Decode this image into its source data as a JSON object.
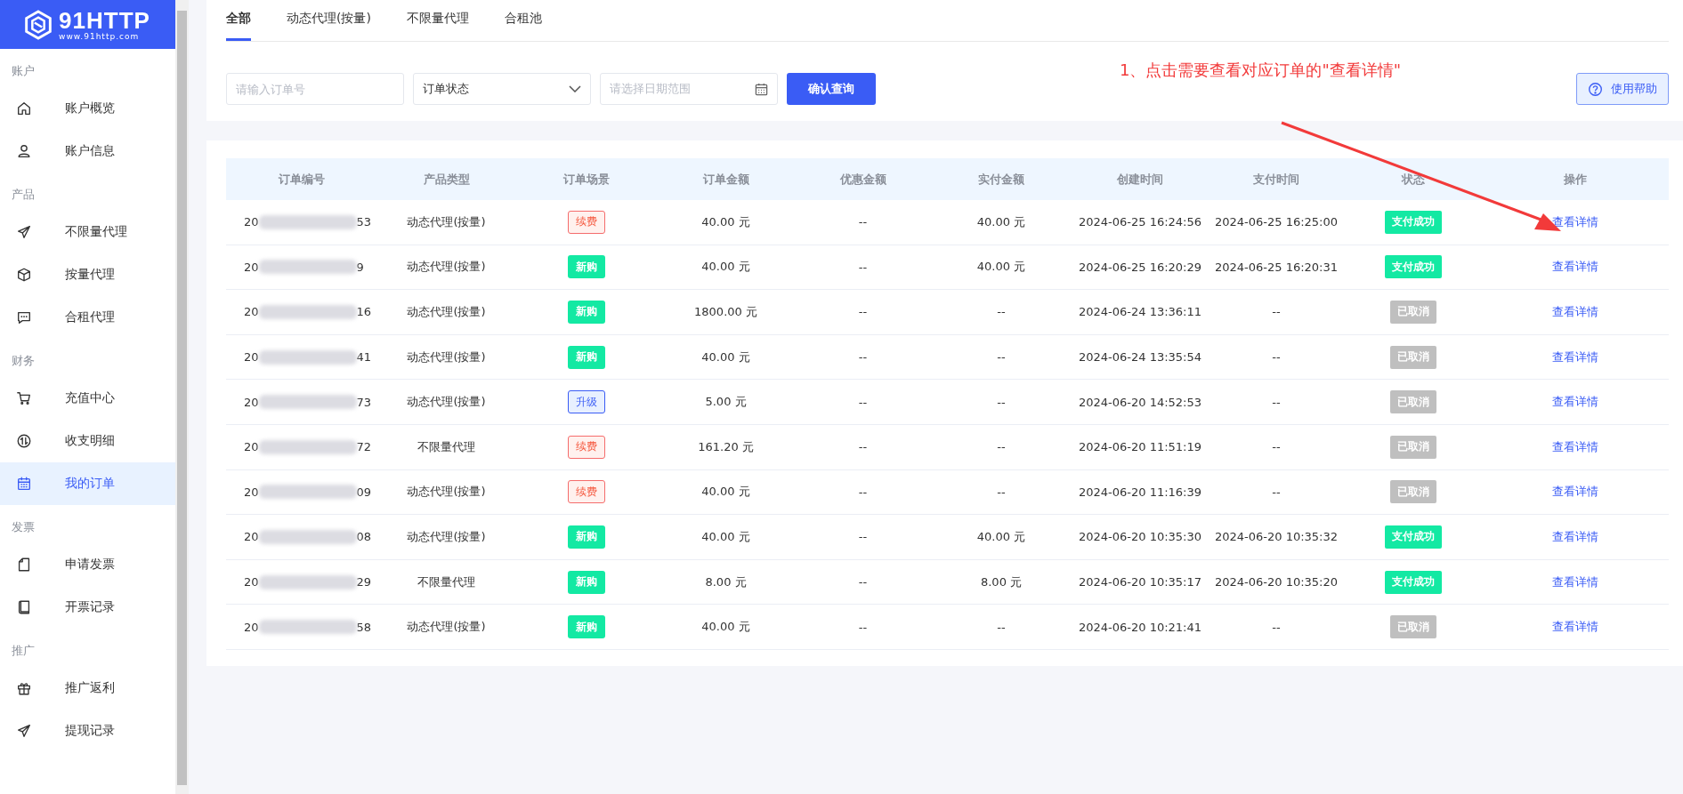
{
  "logo": {
    "name": "91HTTP",
    "url": "www.91http.com"
  },
  "sidebar": {
    "sections": [
      {
        "title": "账户",
        "items": [
          {
            "label": "账户概览",
            "selected": false
          },
          {
            "label": "账户信息",
            "selected": false
          }
        ]
      },
      {
        "title": "产品",
        "items": [
          {
            "label": "不限量代理",
            "selected": false
          },
          {
            "label": "按量代理",
            "selected": false
          },
          {
            "label": "合租代理",
            "selected": false
          }
        ]
      },
      {
        "title": "财务",
        "items": [
          {
            "label": "充值中心",
            "selected": false
          },
          {
            "label": "收支明细",
            "selected": false
          },
          {
            "label": "我的订单",
            "selected": true
          }
        ]
      },
      {
        "title": "发票",
        "items": [
          {
            "label": "申请发票",
            "selected": false
          },
          {
            "label": "开票记录",
            "selected": false
          }
        ]
      },
      {
        "title": "推广",
        "items": [
          {
            "label": "推广返利",
            "selected": false
          },
          {
            "label": "提现记录",
            "selected": false
          }
        ]
      }
    ]
  },
  "tabs": [
    {
      "label": "全部",
      "selected": true
    },
    {
      "label": "动态代理(按量)",
      "selected": false
    },
    {
      "label": "不限量代理",
      "selected": false
    },
    {
      "label": "合租池",
      "selected": false
    }
  ],
  "filters": {
    "order_field": {
      "placeholder": "请输入订单号"
    },
    "status_select": {
      "value": "订单状态"
    },
    "date_field": {
      "placeholder": "请选择日期范围"
    },
    "query_button": "确认查询"
  },
  "help_button": "使用帮助",
  "annotation": {
    "text": "1、点击需要查看对应订单的\"查看详情\""
  },
  "table": {
    "columns": [
      "订单编号",
      "产品类型",
      "订单场景",
      "订单金额",
      "优惠金额",
      "实付金额",
      "创建时间",
      "支付时间",
      "状态",
      "操作"
    ],
    "rows": [
      {
        "order_prefix": "20",
        "order_suffix": "53",
        "product": "动态代理(按量)",
        "scene": {
          "label": "续费",
          "kind": "renew"
        },
        "amount": "40.00 元",
        "discount": "--",
        "paid": "40.00 元",
        "created": "2024-06-25 16:24:56",
        "paid_time": "2024-06-25 16:25:00",
        "status": {
          "label": "支付成功",
          "kind": "paid"
        },
        "action": "查看详情"
      },
      {
        "order_prefix": "20",
        "order_suffix": "9",
        "product": "动态代理(按量)",
        "scene": {
          "label": "新购",
          "kind": "new"
        },
        "amount": "40.00 元",
        "discount": "--",
        "paid": "40.00 元",
        "created": "2024-06-25 16:20:29",
        "paid_time": "2024-06-25 16:20:31",
        "status": {
          "label": "支付成功",
          "kind": "paid"
        },
        "action": "查看详情"
      },
      {
        "order_prefix": "20",
        "order_suffix": "16",
        "product": "动态代理(按量)",
        "scene": {
          "label": "新购",
          "kind": "new"
        },
        "amount": "1800.00 元",
        "discount": "--",
        "paid": "--",
        "created": "2024-06-24 13:36:11",
        "paid_time": "--",
        "status": {
          "label": "已取消",
          "kind": "cancelled"
        },
        "action": "查看详情"
      },
      {
        "order_prefix": "20",
        "order_suffix": "41",
        "product": "动态代理(按量)",
        "scene": {
          "label": "新购",
          "kind": "new"
        },
        "amount": "40.00 元",
        "discount": "--",
        "paid": "--",
        "created": "2024-06-24 13:35:54",
        "paid_time": "--",
        "status": {
          "label": "已取消",
          "kind": "cancelled"
        },
        "action": "查看详情"
      },
      {
        "order_prefix": "20",
        "order_suffix": "73",
        "product": "动态代理(按量)",
        "scene": {
          "label": "升级",
          "kind": "upgrade"
        },
        "amount": "5.00 元",
        "discount": "--",
        "paid": "--",
        "created": "2024-06-20 14:52:53",
        "paid_time": "--",
        "status": {
          "label": "已取消",
          "kind": "cancelled"
        },
        "action": "查看详情"
      },
      {
        "order_prefix": "20",
        "order_suffix": "72",
        "product": "不限量代理",
        "scene": {
          "label": "续费",
          "kind": "renew"
        },
        "amount": "161.20 元",
        "discount": "--",
        "paid": "--",
        "created": "2024-06-20 11:51:19",
        "paid_time": "--",
        "status": {
          "label": "已取消",
          "kind": "cancelled"
        },
        "action": "查看详情"
      },
      {
        "order_prefix": "20",
        "order_suffix": "09",
        "product": "动态代理(按量)",
        "scene": {
          "label": "续费",
          "kind": "renew"
        },
        "amount": "40.00 元",
        "discount": "--",
        "paid": "--",
        "created": "2024-06-20 11:16:39",
        "paid_time": "--",
        "status": {
          "label": "已取消",
          "kind": "cancelled"
        },
        "action": "查看详情"
      },
      {
        "order_prefix": "20",
        "order_suffix": "08",
        "product": "动态代理(按量)",
        "scene": {
          "label": "新购",
          "kind": "new"
        },
        "amount": "40.00 元",
        "discount": "--",
        "paid": "40.00 元",
        "created": "2024-06-20 10:35:30",
        "paid_time": "2024-06-20 10:35:32",
        "status": {
          "label": "支付成功",
          "kind": "paid"
        },
        "action": "查看详情"
      },
      {
        "order_prefix": "20",
        "order_suffix": "29",
        "product": "不限量代理",
        "scene": {
          "label": "新购",
          "kind": "new"
        },
        "amount": "8.00 元",
        "discount": "--",
        "paid": "8.00 元",
        "created": "2024-06-20 10:35:17",
        "paid_time": "2024-06-20 10:35:20",
        "status": {
          "label": "支付成功",
          "kind": "paid"
        },
        "action": "查看详情"
      },
      {
        "order_prefix": "20",
        "order_suffix": "58",
        "product": "动态代理(按量)",
        "scene": {
          "label": "新购",
          "kind": "new"
        },
        "amount": "40.00 元",
        "discount": "--",
        "paid": "--",
        "created": "2024-06-20 10:21:41",
        "paid_time": "--",
        "status": {
          "label": "已取消",
          "kind": "cancelled"
        },
        "action": "查看详情"
      }
    ]
  }
}
